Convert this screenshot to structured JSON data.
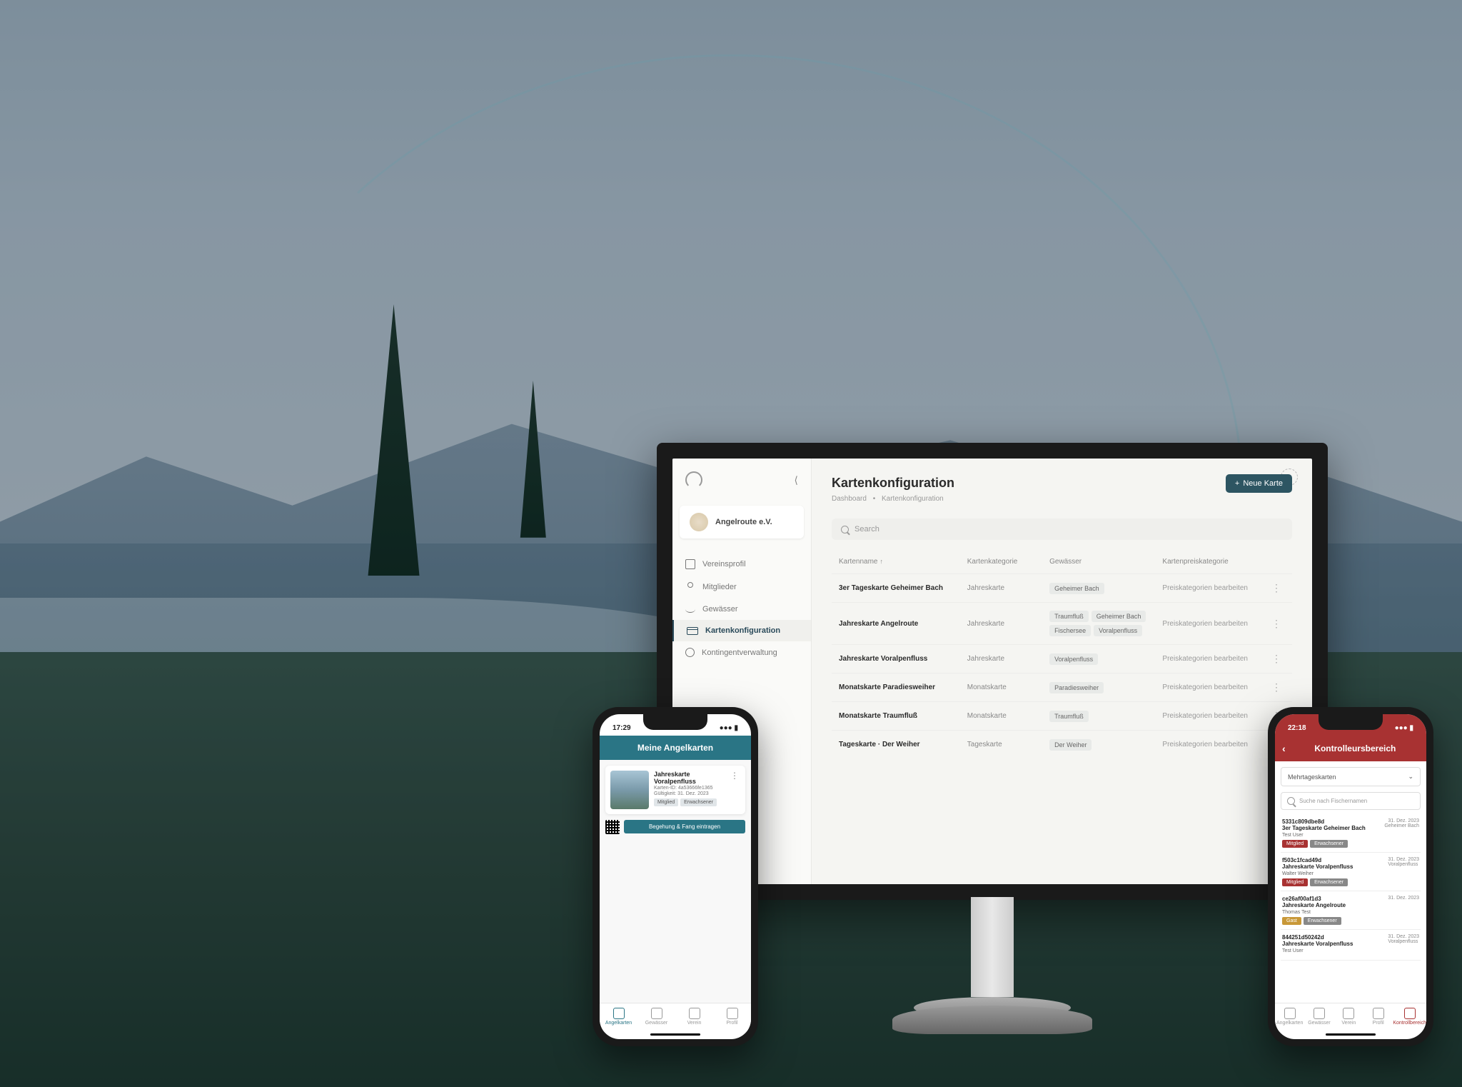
{
  "desktop": {
    "org_name": "Angelroute e.V.",
    "page_title": "Kartenkonfiguration",
    "breadcrumb": {
      "root": "Dashboard",
      "current": "Kartenkonfiguration"
    },
    "new_button": "Neue Karte",
    "search_placeholder": "Search",
    "nav": {
      "profile": "Vereinsprofil",
      "members": "Mitglieder",
      "waters": "Gewässer",
      "cards": "Kartenkonfiguration",
      "quota": "Kontingentverwaltung"
    },
    "columns": {
      "name": "Kartenname",
      "category": "Kartenkategorie",
      "waters": "Gewässer",
      "price": "Kartenpreiskategorie"
    },
    "price_action": "Preiskategorien bearbeiten",
    "rows": [
      {
        "name": "3er Tageskarte Geheimer Bach",
        "category": "Jahreskarte",
        "waters": [
          "Geheimer Bach"
        ]
      },
      {
        "name": "Jahreskarte Angelroute",
        "category": "Jahreskarte",
        "waters": [
          "Traumfluß",
          "Geheimer Bach",
          "Fischersee",
          "Voralpenfluss"
        ]
      },
      {
        "name": "Jahreskarte Voralpenfluss",
        "category": "Jahreskarte",
        "waters": [
          "Voralpenfluss"
        ]
      },
      {
        "name": "Monatskarte Paradiesweiher",
        "category": "Monatskarte",
        "waters": [
          "Paradiesweiher"
        ]
      },
      {
        "name": "Monatskarte Traumfluß",
        "category": "Monatskarte",
        "waters": [
          "Traumfluß"
        ]
      },
      {
        "name": "Tageskarte · Der Weiher",
        "category": "Tageskarte",
        "waters": [
          "Der Weiher"
        ]
      }
    ]
  },
  "phone_left": {
    "time": "17:29",
    "header": "Meine Angelkarten",
    "card": {
      "title": "Jahreskarte Voralpenfluss",
      "id_label": "Karten-ID: 4a53666fe1365",
      "validity": "Gültigkeit: 31. Dez. 2023",
      "badge_member": "Mitglied",
      "badge_adult": "Erwachsener",
      "action": "Begehung & Fang eintragen"
    },
    "tabs": {
      "cards": "Angelkarten",
      "waters": "Gewässer",
      "club": "Verein",
      "profile": "Profil"
    }
  },
  "phone_right": {
    "time": "22:18",
    "header": "Kontrolleursbereich",
    "dropdown": "Mehrtageskarten",
    "search_placeholder": "Suche nach Fischernamen",
    "items": [
      {
        "id": "5331c809dbe8d",
        "title": "3er Tageskarte Geheimer Bach",
        "date": "31. Dez. 2023",
        "location": "Geheimer Bach",
        "user": "Test User",
        "badges": [
          "member",
          "adult"
        ]
      },
      {
        "id": "f503c1fcad49d",
        "title": "Jahreskarte Voralpenfluss",
        "date": "31. Dez. 2023",
        "location": "Voralpenfluss",
        "user": "Walter Weiher",
        "badges": [
          "member",
          "adult"
        ]
      },
      {
        "id": "ce26af00af1d3",
        "title": "Jahreskarte Angelroute",
        "date": "31. Dez. 2023",
        "location": "",
        "user": "Thomas Test",
        "badges": [
          "guest",
          "adult"
        ]
      },
      {
        "id": "844251d50242d",
        "title": "Jahreskarte Voralpenfluss",
        "date": "31. Dez. 2023",
        "location": "Voralpenfluss",
        "user": "Test User",
        "badges": []
      }
    ],
    "badge_labels": {
      "member": "Mitglied",
      "adult": "Erwachsener",
      "guest": "Gast"
    },
    "tabs": {
      "cards": "Angelkarten",
      "waters": "Gewässer",
      "club": "Verein",
      "profile": "Profil",
      "control": "Kontrollbereich"
    }
  }
}
